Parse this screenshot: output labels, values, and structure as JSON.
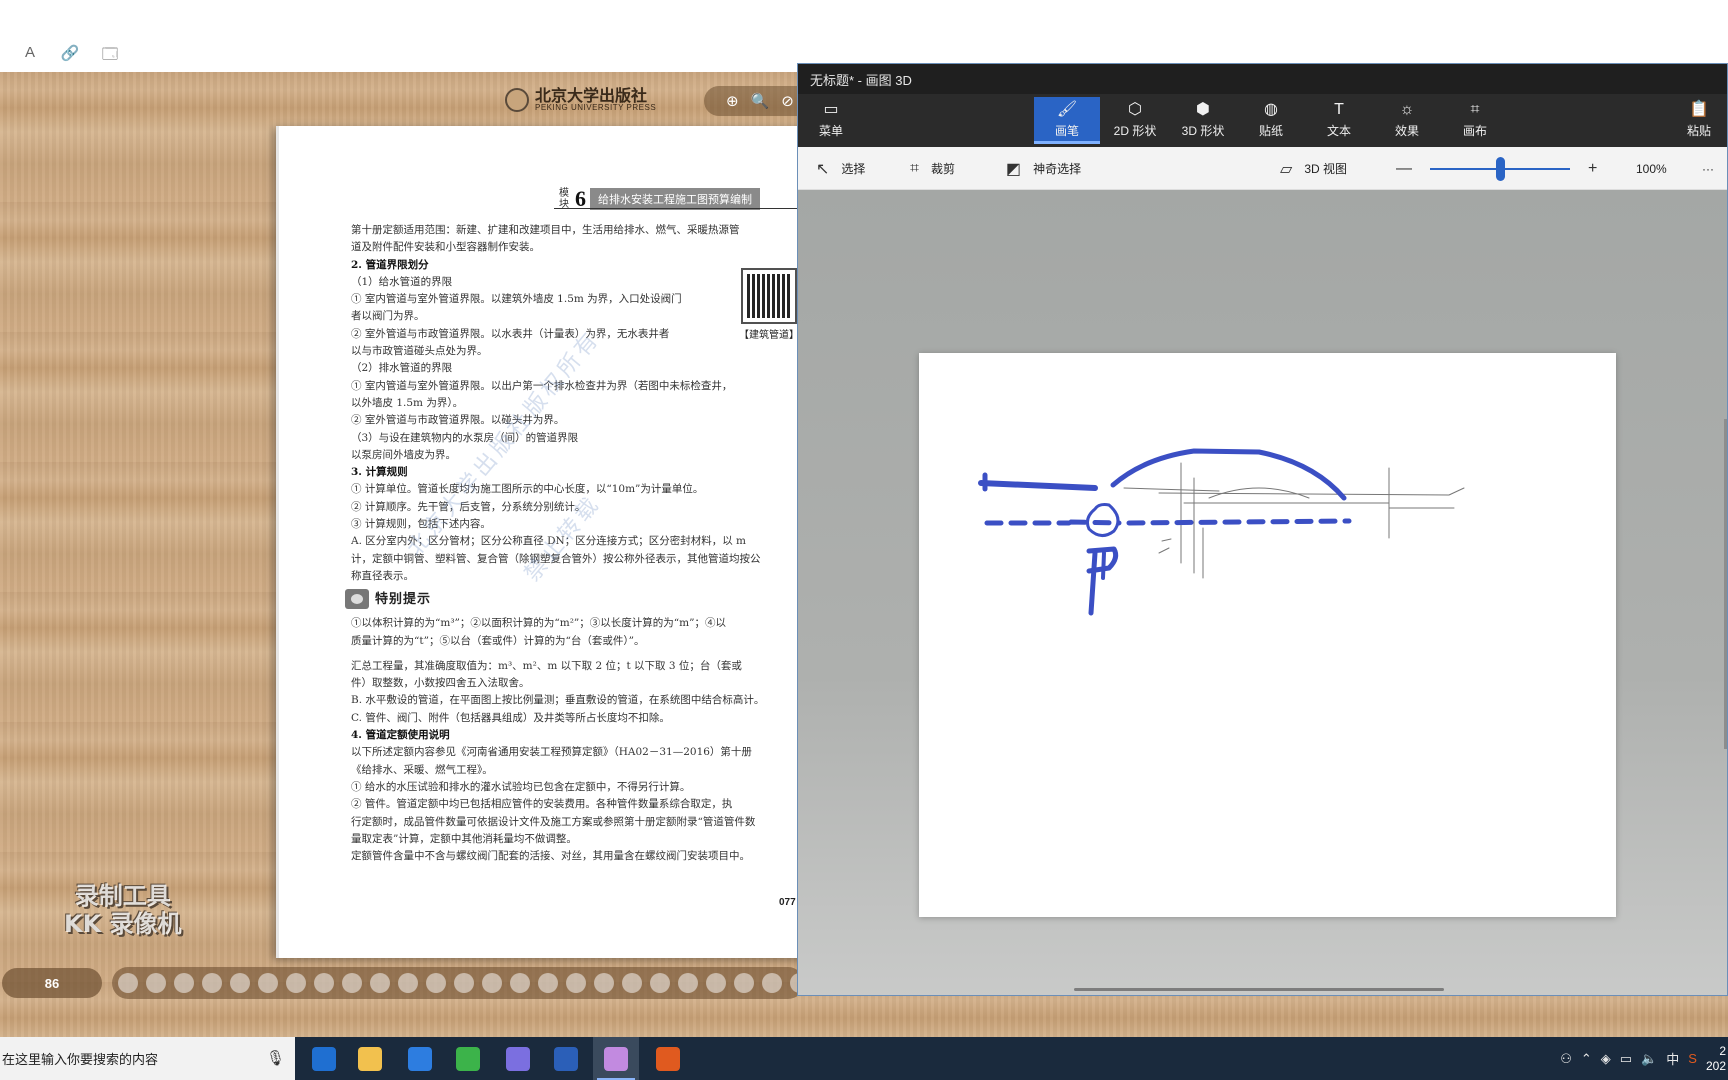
{
  "browser": {
    "icons": [
      "font-icon",
      "link-icon",
      "window-icon"
    ],
    "icon_glyphs": [
      "A",
      "🔗",
      "🗔"
    ]
  },
  "book": {
    "publisher_name": "北京大学出版社",
    "publisher_en": "PEKING UNIVERSITY PRESS",
    "zoom_glyphs": [
      "⊕",
      "🔍",
      "⊘"
    ],
    "module_label": "模块",
    "module_number": "6",
    "module_title": "给排水安装工程施工图预算编制",
    "qr_caption": "【建筑管道】",
    "lines": [
      {
        "t": "第十册定额适用范围：新建、扩建和改建项目中，生活用给排水、燃气、采暖热源管",
        "c": ""
      },
      {
        "t": "道及附件配件安装和小型容器制作安装。",
        "c": ""
      },
      {
        "t": "2. 管道界限划分",
        "c": "b"
      },
      {
        "t": "（1）给水管道的界限",
        "c": ""
      },
      {
        "t": "① 室内管道与室外管道界限。以建筑外墙皮 1.5m 为界，入口处设阀门",
        "c": ""
      },
      {
        "t": "者以阀门为界。",
        "c": ""
      },
      {
        "t": "② 室外管道与市政管道界限。以水表井（计量表）为界，无水表井者",
        "c": ""
      },
      {
        "t": "以与市政管道碰头点处为界。",
        "c": ""
      },
      {
        "t": "（2）排水管道的界限",
        "c": ""
      },
      {
        "t": "① 室内管道与室外管道界限。以出户第一个排水检查井为界（若图中未标检查井，",
        "c": ""
      },
      {
        "t": "以外墙皮 1.5m 为界）。",
        "c": ""
      },
      {
        "t": "② 室外管道与市政管道界限。以碰头井为界。",
        "c": ""
      },
      {
        "t": "（3）与设在建筑物内的水泵房（间）的管道界限",
        "c": ""
      },
      {
        "t": "以泵房间外墙皮为界。",
        "c": ""
      },
      {
        "t": "3. 计算规则",
        "c": "b"
      },
      {
        "t": "① 计算单位。管道长度均为施工图所示的中心长度，以“10m”为计量单位。",
        "c": ""
      },
      {
        "t": "② 计算顺序。先干管，后支管，分系统分别统计。",
        "c": ""
      },
      {
        "t": "③ 计算规则，包括下述内容。",
        "c": ""
      },
      {
        "t": "A. 区分室内外；区分管材；区分公称直径 DN；区分连接方式；区分密封材料，以 m",
        "c": ""
      },
      {
        "t": "计，定额中铜管、塑料管、复合管（除钢塑复合管外）按公称外径表示，其他管道均按公",
        "c": ""
      },
      {
        "t": "称直径表示。",
        "c": ""
      }
    ],
    "tip_title": "特别提示",
    "lines2": [
      {
        "t": "①以体积计算的为“m³”；②以面积计算的为“m²”；③以长度计算的为“m”；④以",
        "c": ""
      },
      {
        "t": "质量计算的为“t”；⑤以台（套或件）计算的为“台（套或件）”。",
        "c": ""
      }
    ],
    "lines3": [
      {
        "t": "汇总工程量，其准确度取值为：m³、m²、m 以下取 2 位；t 以下取 3 位；台（套或",
        "c": ""
      },
      {
        "t": "件）取整数，小数按四舍五入法取舍。",
        "c": ""
      },
      {
        "t": "B. 水平敷设的管道，在平面图上按比例量测；垂直敷设的管道，在系统图中结合标高计。",
        "c": ""
      },
      {
        "t": "C. 管件、阀门、附件（包括器具组成）及井类等所占长度均不扣除。",
        "c": ""
      },
      {
        "t": "4. 管道定额使用说明",
        "c": "b"
      },
      {
        "t": "以下所述定额内容参见《河南省通用安装工程预算定额》（HA02－31—2016）第十册",
        "c": ""
      },
      {
        "t": "《给排水、采暖、燃气工程》。",
        "c": ""
      },
      {
        "t": "① 给水的水压试验和排水的灌水试验均已包含在定额中，不得另行计算。",
        "c": ""
      },
      {
        "t": "② 管件。管道定额中均已包括相应管件的安装费用。各种管件数量系综合取定，执",
        "c": ""
      },
      {
        "t": "行定额时，成品管件数量可依据设计文件及施工方案或参照第十册定额附录“管道管件数",
        "c": ""
      },
      {
        "t": "量取定表”计算，定额中其他消耗量均不做调整。",
        "c": ""
      },
      {
        "t": "定额管件含量中不含与螺纹阀门配套的活接、对丝，其用量含在螺纹阀门安装项目中。",
        "c": ""
      }
    ],
    "page_number": "077",
    "watermark_1": "北京大学出版社版权所有",
    "watermark_2": "禁止转载",
    "current_page": "86",
    "recorder_line1": "录制工具",
    "recorder_line2": "KK 录像机"
  },
  "paint3d": {
    "title": "无标题* - 画图 3D",
    "menu_label": "菜单",
    "tools": [
      {
        "label": "画笔",
        "icon": "brush-icon",
        "glyph": "🖌",
        "active": true
      },
      {
        "label": "2D 形状",
        "icon": "shapes-2d-icon",
        "glyph": "⬡",
        "active": false
      },
      {
        "label": "3D 形状",
        "icon": "cube-icon",
        "glyph": "⬢",
        "active": false
      },
      {
        "label": "贴纸",
        "icon": "sticker-icon",
        "glyph": "◍",
        "active": false
      },
      {
        "label": "文本",
        "icon": "text-icon",
        "glyph": "T",
        "active": false
      },
      {
        "label": "效果",
        "icon": "effects-icon",
        "glyph": "☼",
        "active": false
      },
      {
        "label": "画布",
        "icon": "canvas-icon",
        "glyph": "⌗",
        "active": false
      }
    ],
    "paste_label": "粘贴",
    "select_label": "选择",
    "crop_label": "裁剪",
    "magic_select_label": "神奇选择",
    "view3d_label": "3D 视图",
    "zoom_minus": "—",
    "zoom_plus": "+",
    "zoom_level": "100%",
    "more_label": "···",
    "zoom_fraction": 0.5,
    "stroke_color": "#3b4fc4"
  },
  "taskbar": {
    "search_placeholder": "在这里输入你要搜索的内容",
    "apps": [
      {
        "name": "edge-icon",
        "color": "#1f6fd1",
        "active": false
      },
      {
        "name": "file-explorer-icon",
        "color": "#f2c14e",
        "active": false
      },
      {
        "name": "browser-app-icon",
        "color": "#2d7de0",
        "active": false
      },
      {
        "name": "wechat-icon",
        "color": "#3cb34a",
        "active": false
      },
      {
        "name": "app-purple-icon",
        "color": "#7b6fe0",
        "active": false
      },
      {
        "name": "word-icon",
        "color": "#2b5fb8",
        "active": false
      },
      {
        "name": "paint3d-icon",
        "color": "#c28ae0",
        "active": true
      },
      {
        "name": "recorder-icon",
        "color": "#e05a1f",
        "active": false
      }
    ],
    "ime": "中",
    "clock_time": "2",
    "clock_date": "202"
  }
}
